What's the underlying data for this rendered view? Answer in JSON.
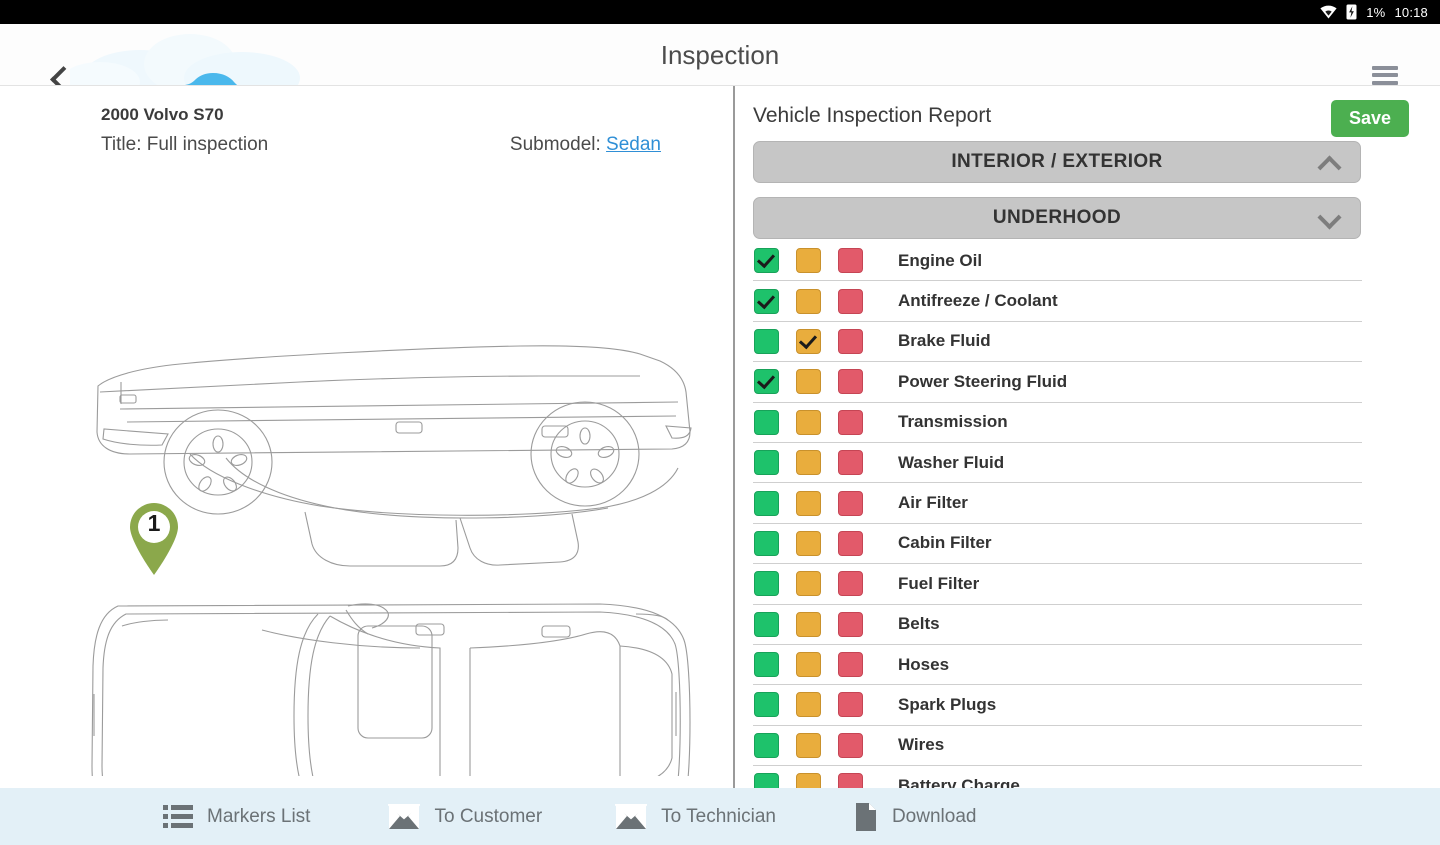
{
  "statusbar": {
    "wifi_icon": "wifi-icon",
    "battery_icon": "battery-charging-icon",
    "battery_level": "1%",
    "time": "10:18"
  },
  "appbar": {
    "back_icon": "chevron-left-icon",
    "logo_icon": "car-logo-icon",
    "title": "Inspection",
    "menu_icon": "hamburger-menu-icon"
  },
  "vehicle": {
    "name": "2000 Volvo S70",
    "title_label": "Title: Full inspection",
    "submodel_label": "Submodel:",
    "submodel_value": "Sedan"
  },
  "diagram": {
    "side_view_icon": "car-side-view-outline",
    "top_view_icon": "car-top-view-outline",
    "marker_number": "1",
    "marker_color": "#8ba84b"
  },
  "report": {
    "title": "Vehicle Inspection Report",
    "save_label": "Save",
    "sections": [
      {
        "label": "INTERIOR / EXTERIOR",
        "chevron": "chevron-up-icon",
        "expanded": false
      },
      {
        "label": "UNDERHOOD",
        "chevron": "chevron-down-icon",
        "expanded": true
      }
    ],
    "status_colors": {
      "good": "#1ec26b",
      "warn": "#e9ad3d",
      "bad": "#e25a6a"
    },
    "items": [
      {
        "label": "Engine Oil",
        "checked": "good"
      },
      {
        "label": "Antifreeze / Coolant",
        "checked": "good"
      },
      {
        "label": "Brake Fluid",
        "checked": "warn"
      },
      {
        "label": "Power Steering Fluid",
        "checked": "good"
      },
      {
        "label": "Transmission",
        "checked": "none"
      },
      {
        "label": "Washer Fluid",
        "checked": "none"
      },
      {
        "label": "Air Filter",
        "checked": "none"
      },
      {
        "label": "Cabin Filter",
        "checked": "none"
      },
      {
        "label": "Fuel Filter",
        "checked": "none"
      },
      {
        "label": "Belts",
        "checked": "none"
      },
      {
        "label": "Hoses",
        "checked": "none"
      },
      {
        "label": "Spark Plugs",
        "checked": "none"
      },
      {
        "label": "Wires",
        "checked": "none"
      },
      {
        "label": "Battery Charge",
        "checked": "none"
      }
    ]
  },
  "bottombar": {
    "items": [
      {
        "label": "Markers List",
        "icon": "list-icon"
      },
      {
        "label": "To Customer",
        "icon": "envelope-icon"
      },
      {
        "label": "To Technician",
        "icon": "envelope-icon"
      },
      {
        "label": "Download",
        "icon": "document-icon"
      }
    ]
  }
}
